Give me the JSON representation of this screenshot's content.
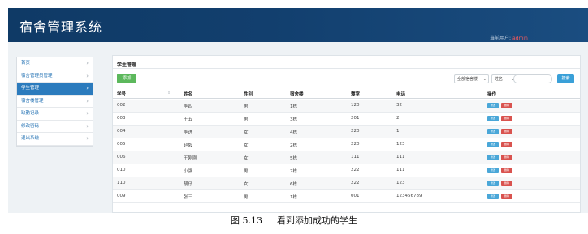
{
  "header": {
    "title": "宿舍管理系统",
    "user_label": "当前用户:",
    "user_name": "admin"
  },
  "sidebar": {
    "items": [
      {
        "label": "首页"
      },
      {
        "label": "宿舍管理员管理"
      },
      {
        "label": "学生管理",
        "active": true
      },
      {
        "label": "宿舍楼管理"
      },
      {
        "label": "缺勤记录"
      },
      {
        "label": "修改密码"
      },
      {
        "label": "退出系统"
      }
    ]
  },
  "main": {
    "panel_title": "学生管理",
    "add_label": "添加",
    "building_filter": "全部宿舍楼",
    "field_filter": "姓名",
    "search_placeholder": "",
    "search_label": "搜索",
    "columns": [
      "学号",
      "姓名",
      "性别",
      "宿舍楼",
      "寝室",
      "电话",
      "操作"
    ],
    "rows": [
      [
        "002",
        "李四",
        "男",
        "1栋",
        "120",
        "32"
      ],
      [
        "003",
        "王五",
        "男",
        "3栋",
        "201",
        "2"
      ],
      [
        "004",
        "李进",
        "女",
        "4栋",
        "220",
        "1"
      ],
      [
        "005",
        "赵毅",
        "女",
        "2栋",
        "220",
        "123"
      ],
      [
        "006",
        "王刚刚",
        "女",
        "5栋",
        "111",
        "111"
      ],
      [
        "010",
        "小强",
        "男",
        "7栋",
        "222",
        "111"
      ],
      [
        "110",
        "靓仔",
        "女",
        "6栋",
        "222",
        "123"
      ],
      [
        "009",
        "张三",
        "男",
        "1栋",
        "001",
        "123456789"
      ]
    ],
    "edit_label": "修改",
    "delete_label": "删除"
  },
  "caption": {
    "number": "图 5.13",
    "text": "看到添加成功的学生"
  },
  "colors": {
    "header_bg": "#123f6e",
    "active_nav": "#2b7bbd",
    "add_button": "#5cb85c",
    "search_button": "#3aa0d8",
    "edit_button": "#4aa7d8",
    "delete_button": "#d9534f"
  }
}
